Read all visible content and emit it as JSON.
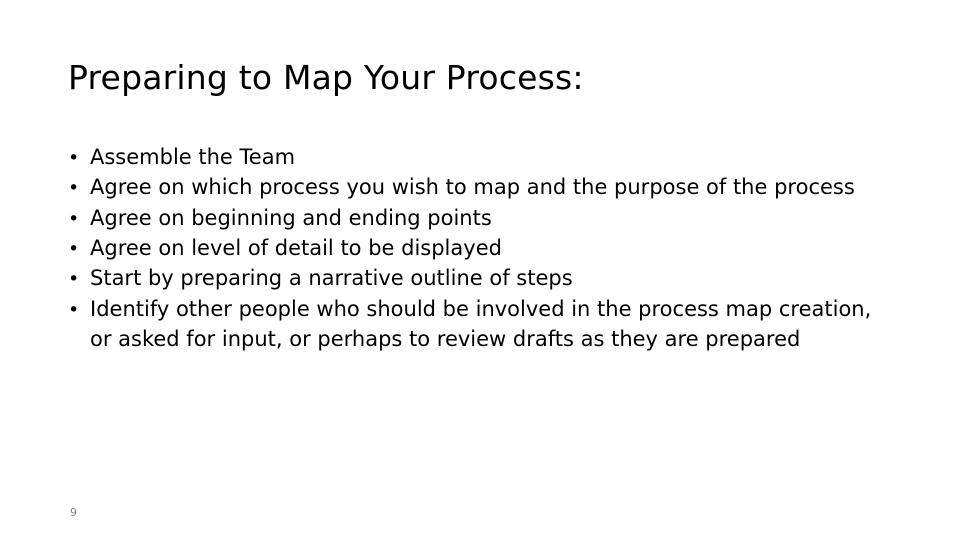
{
  "slide": {
    "title": "Preparing to Map Your Process:",
    "bullet_marker": "•",
    "bullets": [
      "Assemble the Team",
      "Agree on which process you wish to map and the purpose of the process",
      "Agree on beginning and ending points",
      "Agree on level of detail to be displayed",
      "Start by preparing a narrative outline of steps",
      "Identify other people who should be involved in the process map creation, or asked for input, or perhaps to review drafts as they are prepared"
    ],
    "page_number": "9",
    "colors": {
      "text": "#000000",
      "background": "#ffffff",
      "page_number": "#808080"
    }
  }
}
